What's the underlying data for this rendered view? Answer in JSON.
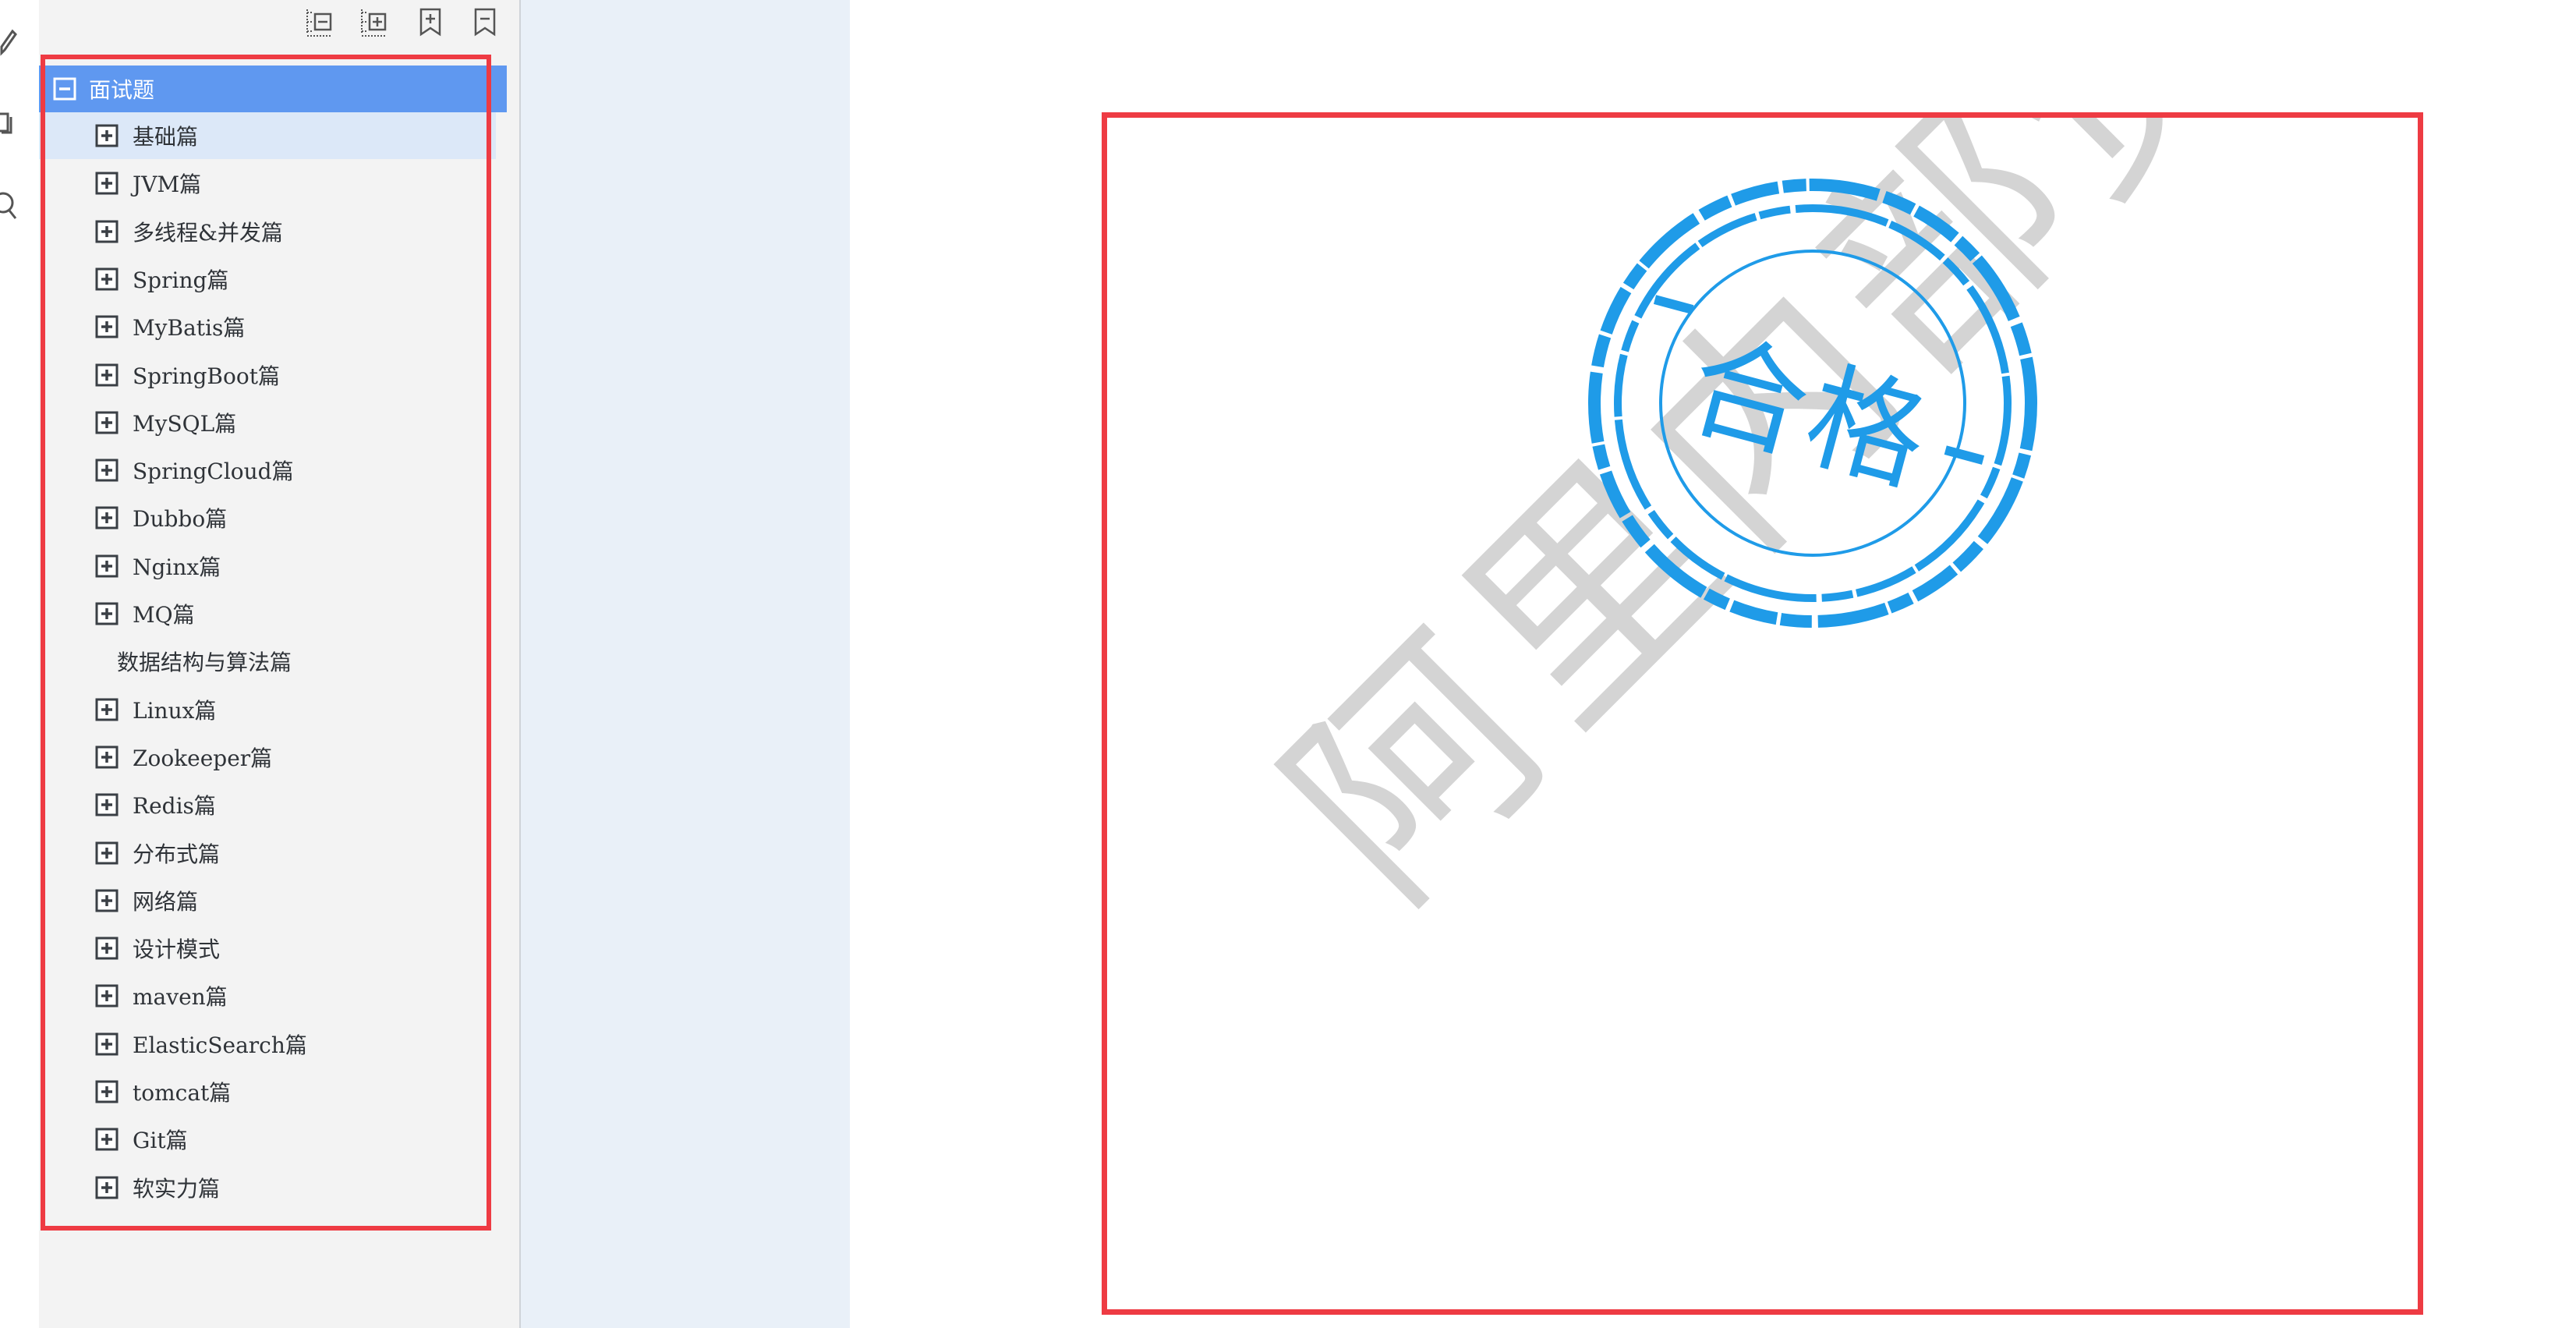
{
  "toolbar": {
    "buttons": [
      {
        "id": "collapse-all",
        "icon": "collapse-all-icon"
      },
      {
        "id": "expand-all",
        "icon": "expand-all-icon"
      },
      {
        "id": "add-bookmark",
        "icon": "add-bookmark-icon"
      },
      {
        "id": "remove-bookmark",
        "icon": "remove-bookmark-icon"
      }
    ]
  },
  "rail_icons": [
    "edit-icon",
    "copy-icon",
    "search-icon"
  ],
  "tree": {
    "root": {
      "label": "面试题",
      "expanded": true
    },
    "items": [
      {
        "label": "基础篇",
        "has_children": true
      },
      {
        "label": "JVM篇",
        "has_children": true
      },
      {
        "label": "多线程&并发篇",
        "has_children": true
      },
      {
        "label": "Spring篇",
        "has_children": true
      },
      {
        "label": "MyBatis篇",
        "has_children": true
      },
      {
        "label": "SpringBoot篇",
        "has_children": true
      },
      {
        "label": "MySQL篇",
        "has_children": true
      },
      {
        "label": "SpringCloud篇",
        "has_children": true
      },
      {
        "label": "Dubbo篇",
        "has_children": true
      },
      {
        "label": "Nginx篇",
        "has_children": true
      },
      {
        "label": "MQ篇",
        "has_children": true
      },
      {
        "label": "数据结构与算法篇",
        "has_children": false
      },
      {
        "label": "Linux篇",
        "has_children": true
      },
      {
        "label": "Zookeeper篇",
        "has_children": true
      },
      {
        "label": "Redis篇",
        "has_children": true
      },
      {
        "label": "分布式篇",
        "has_children": true
      },
      {
        "label": "网络篇",
        "has_children": true
      },
      {
        "label": "设计模式",
        "has_children": true
      },
      {
        "label": "maven篇",
        "has_children": true
      },
      {
        "label": "ElasticSearch篇",
        "has_children": true
      },
      {
        "label": "tomcat篇",
        "has_children": true
      },
      {
        "label": "Git篇",
        "has_children": true
      },
      {
        "label": "软实力篇",
        "has_children": true
      }
    ]
  },
  "page": {
    "watermark": "阿里内部资料",
    "stamp_text": "合格"
  },
  "colors": {
    "selection_blue": "#5f98f0",
    "highlight_red": "#ee3b43",
    "stamp_blue": "#1f9be8",
    "watermark_gray": "#d4d4d4"
  }
}
